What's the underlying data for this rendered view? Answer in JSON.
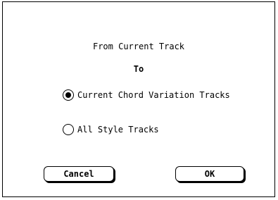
{
  "dialog": {
    "heading_from": "From Current Track",
    "heading_to": "To",
    "options": [
      {
        "label": "Current Chord Variation Tracks",
        "selected": true
      },
      {
        "label": "All Style Tracks",
        "selected": false
      }
    ],
    "cancel_label": "Cancel",
    "ok_label": "OK"
  }
}
